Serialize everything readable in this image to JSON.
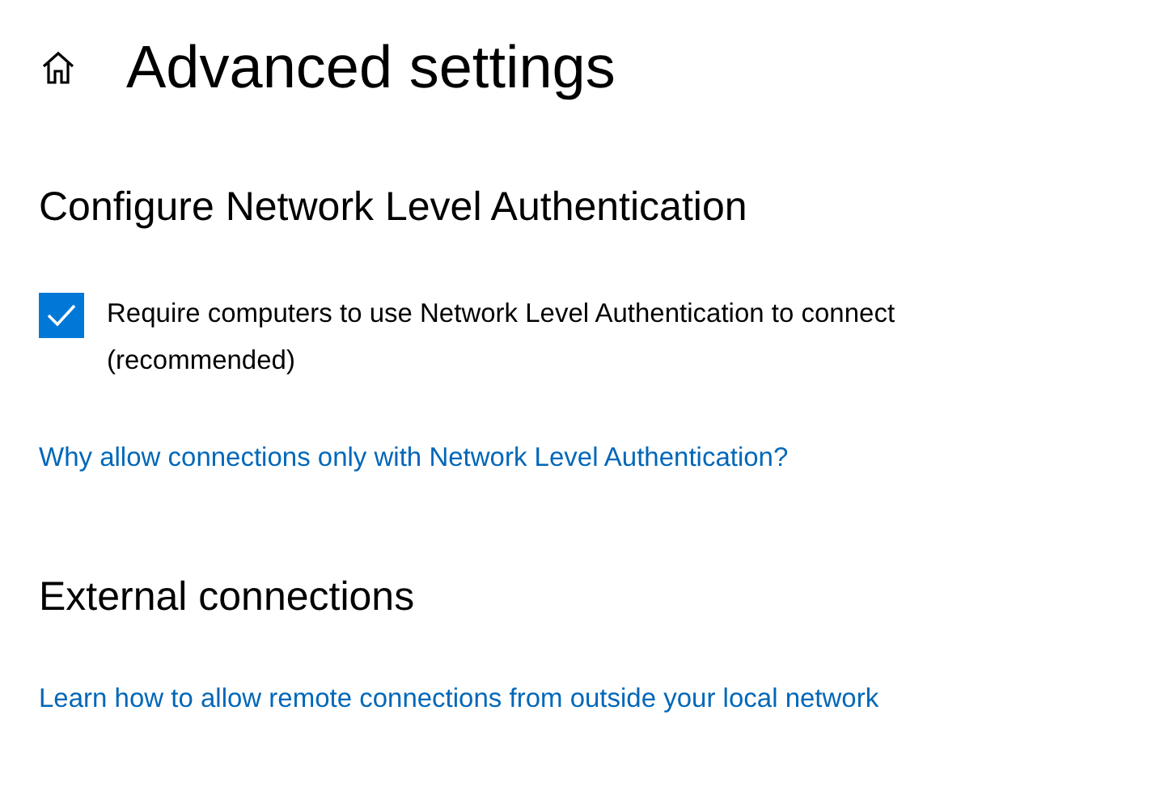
{
  "page": {
    "title": "Advanced settings"
  },
  "sections": [
    {
      "heading": "Configure Network Level Authentication",
      "checkbox": {
        "label": "Require computers to use Network Level Authentication to connect (recommended)",
        "checked": true
      },
      "link": "Why allow connections only with Network Level Authentication?"
    },
    {
      "heading": "External connections",
      "link": "Learn how to allow remote connections from outside your local network"
    }
  ]
}
